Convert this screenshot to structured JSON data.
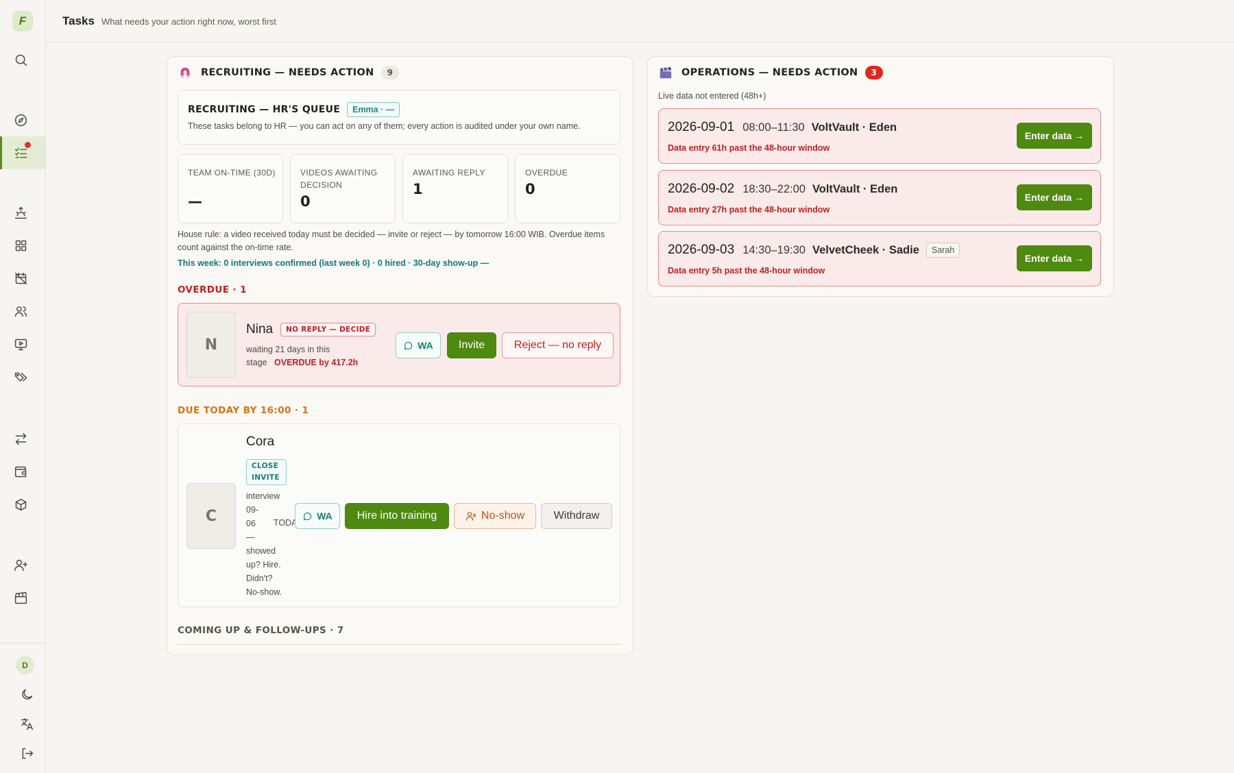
{
  "app": {
    "logo_letter": "F",
    "user_initial": "D"
  },
  "header": {
    "title": "Tasks",
    "subtitle": "What needs your action right now, worst first"
  },
  "sidebar": {
    "icons": [
      "search-icon",
      "compass-icon",
      "tasks-icon",
      "sunrise-icon",
      "grid-icon",
      "calendar-off-icon",
      "users-icon",
      "monitor-play-icon",
      "tags-icon",
      "transfer-icon",
      "wallet-icon",
      "package-icon",
      "user-plus-icon",
      "clapperboard-icon",
      "moon-icon",
      "translate-icon",
      "logout-icon"
    ]
  },
  "recruiting": {
    "title": "RECRUITING — NEEDS ACTION",
    "count": "9",
    "queue": {
      "title": "RECRUITING — HR'S QUEUE",
      "owner_pill": "Emma · —",
      "description": "These tasks belong to HR — you can act on any of them; every action is audited under your own name."
    },
    "stats": [
      {
        "label": "TEAM ON-TIME (30D)",
        "value": "—"
      },
      {
        "label": "VIDEOS AWAITING DECISION",
        "value": "0"
      },
      {
        "label": "AWAITING REPLY",
        "value": "1"
      },
      {
        "label": "OVERDUE",
        "value": "0"
      }
    ],
    "house_rule": "House rule: a video received today must be decided — invite or reject — by tomorrow 16:00 WIB. Overdue items count against the on-time rate.",
    "this_week": "This week: 0 interviews confirmed (last week 0) · 0 hired · 30-day show-up —",
    "overdue_section": {
      "title": "OVERDUE · 1",
      "candidate": {
        "initial": "N",
        "name": "Nina",
        "tag": "NO REPLY — DECIDE",
        "meta_line1": "waiting 21 days in this",
        "meta_line2": "stage",
        "overdue_by": "OVERDUE by 417.2h",
        "wa_label": "WA",
        "invite_label": "Invite",
        "reject_label": "Reject — no reply"
      }
    },
    "today_section": {
      "title": "DUE TODAY BY 16:00 · 1",
      "candidate": {
        "initial": "C",
        "name": "Cora",
        "tag_line1": "CLOSE",
        "tag_line2": "INVITE",
        "meta_lines": [
          "interview",
          "09-",
          "06",
          "—",
          "showed",
          "up? Hire.",
          "Didn't?",
          "No-show."
        ],
        "today_label": "TODAY",
        "wa_label": "WA",
        "hire_label": "Hire into training",
        "noshow_label": "No-show",
        "withdraw_label": "Withdraw"
      }
    },
    "coming_section": {
      "title": "COMING UP & FOLLOW-UPS · 7"
    }
  },
  "operations": {
    "title": "OPERATIONS — NEEDS ACTION",
    "count": "3",
    "subtitle": "Live data not entered (48h+)",
    "items": [
      {
        "date": "2026-09-01",
        "time": "08:00–11:30",
        "who": "VoltVault · Eden",
        "pill": "",
        "warning": "Data entry 61h past the 48-hour window",
        "button": "Enter data →"
      },
      {
        "date": "2026-09-02",
        "time": "18:30–22:00",
        "who": "VoltVault · Eden",
        "pill": "",
        "warning": "Data entry 27h past the 48-hour window",
        "button": "Enter data →"
      },
      {
        "date": "2026-09-03",
        "time": "14:30–19:30",
        "who": "VelvetCheek · Sadie",
        "pill": "Sarah",
        "warning": "Data entry 5h past the 48-hour window",
        "button": "Enter data →"
      }
    ]
  },
  "colors": {
    "accent_green": "#4f8a10",
    "danger_red": "#c41d1d",
    "teal": "#0f7c72",
    "warning_orange": "#d7730f"
  }
}
